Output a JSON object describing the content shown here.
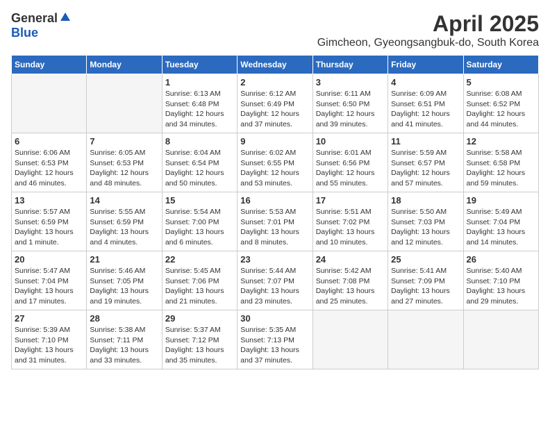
{
  "header": {
    "logo_general": "General",
    "logo_blue": "Blue",
    "month_title": "April 2025",
    "location": "Gimcheon, Gyeongsangbuk-do, South Korea"
  },
  "weekdays": [
    "Sunday",
    "Monday",
    "Tuesday",
    "Wednesday",
    "Thursday",
    "Friday",
    "Saturday"
  ],
  "weeks": [
    [
      {
        "day": "",
        "info": ""
      },
      {
        "day": "",
        "info": ""
      },
      {
        "day": "1",
        "info": "Sunrise: 6:13 AM\nSunset: 6:48 PM\nDaylight: 12 hours and 34 minutes."
      },
      {
        "day": "2",
        "info": "Sunrise: 6:12 AM\nSunset: 6:49 PM\nDaylight: 12 hours and 37 minutes."
      },
      {
        "day": "3",
        "info": "Sunrise: 6:11 AM\nSunset: 6:50 PM\nDaylight: 12 hours and 39 minutes."
      },
      {
        "day": "4",
        "info": "Sunrise: 6:09 AM\nSunset: 6:51 PM\nDaylight: 12 hours and 41 minutes."
      },
      {
        "day": "5",
        "info": "Sunrise: 6:08 AM\nSunset: 6:52 PM\nDaylight: 12 hours and 44 minutes."
      }
    ],
    [
      {
        "day": "6",
        "info": "Sunrise: 6:06 AM\nSunset: 6:53 PM\nDaylight: 12 hours and 46 minutes."
      },
      {
        "day": "7",
        "info": "Sunrise: 6:05 AM\nSunset: 6:53 PM\nDaylight: 12 hours and 48 minutes."
      },
      {
        "day": "8",
        "info": "Sunrise: 6:04 AM\nSunset: 6:54 PM\nDaylight: 12 hours and 50 minutes."
      },
      {
        "day": "9",
        "info": "Sunrise: 6:02 AM\nSunset: 6:55 PM\nDaylight: 12 hours and 53 minutes."
      },
      {
        "day": "10",
        "info": "Sunrise: 6:01 AM\nSunset: 6:56 PM\nDaylight: 12 hours and 55 minutes."
      },
      {
        "day": "11",
        "info": "Sunrise: 5:59 AM\nSunset: 6:57 PM\nDaylight: 12 hours and 57 minutes."
      },
      {
        "day": "12",
        "info": "Sunrise: 5:58 AM\nSunset: 6:58 PM\nDaylight: 12 hours and 59 minutes."
      }
    ],
    [
      {
        "day": "13",
        "info": "Sunrise: 5:57 AM\nSunset: 6:59 PM\nDaylight: 13 hours and 1 minute."
      },
      {
        "day": "14",
        "info": "Sunrise: 5:55 AM\nSunset: 6:59 PM\nDaylight: 13 hours and 4 minutes."
      },
      {
        "day": "15",
        "info": "Sunrise: 5:54 AM\nSunset: 7:00 PM\nDaylight: 13 hours and 6 minutes."
      },
      {
        "day": "16",
        "info": "Sunrise: 5:53 AM\nSunset: 7:01 PM\nDaylight: 13 hours and 8 minutes."
      },
      {
        "day": "17",
        "info": "Sunrise: 5:51 AM\nSunset: 7:02 PM\nDaylight: 13 hours and 10 minutes."
      },
      {
        "day": "18",
        "info": "Sunrise: 5:50 AM\nSunset: 7:03 PM\nDaylight: 13 hours and 12 minutes."
      },
      {
        "day": "19",
        "info": "Sunrise: 5:49 AM\nSunset: 7:04 PM\nDaylight: 13 hours and 14 minutes."
      }
    ],
    [
      {
        "day": "20",
        "info": "Sunrise: 5:47 AM\nSunset: 7:04 PM\nDaylight: 13 hours and 17 minutes."
      },
      {
        "day": "21",
        "info": "Sunrise: 5:46 AM\nSunset: 7:05 PM\nDaylight: 13 hours and 19 minutes."
      },
      {
        "day": "22",
        "info": "Sunrise: 5:45 AM\nSunset: 7:06 PM\nDaylight: 13 hours and 21 minutes."
      },
      {
        "day": "23",
        "info": "Sunrise: 5:44 AM\nSunset: 7:07 PM\nDaylight: 13 hours and 23 minutes."
      },
      {
        "day": "24",
        "info": "Sunrise: 5:42 AM\nSunset: 7:08 PM\nDaylight: 13 hours and 25 minutes."
      },
      {
        "day": "25",
        "info": "Sunrise: 5:41 AM\nSunset: 7:09 PM\nDaylight: 13 hours and 27 minutes."
      },
      {
        "day": "26",
        "info": "Sunrise: 5:40 AM\nSunset: 7:10 PM\nDaylight: 13 hours and 29 minutes."
      }
    ],
    [
      {
        "day": "27",
        "info": "Sunrise: 5:39 AM\nSunset: 7:10 PM\nDaylight: 13 hours and 31 minutes."
      },
      {
        "day": "28",
        "info": "Sunrise: 5:38 AM\nSunset: 7:11 PM\nDaylight: 13 hours and 33 minutes."
      },
      {
        "day": "29",
        "info": "Sunrise: 5:37 AM\nSunset: 7:12 PM\nDaylight: 13 hours and 35 minutes."
      },
      {
        "day": "30",
        "info": "Sunrise: 5:35 AM\nSunset: 7:13 PM\nDaylight: 13 hours and 37 minutes."
      },
      {
        "day": "",
        "info": ""
      },
      {
        "day": "",
        "info": ""
      },
      {
        "day": "",
        "info": ""
      }
    ]
  ]
}
